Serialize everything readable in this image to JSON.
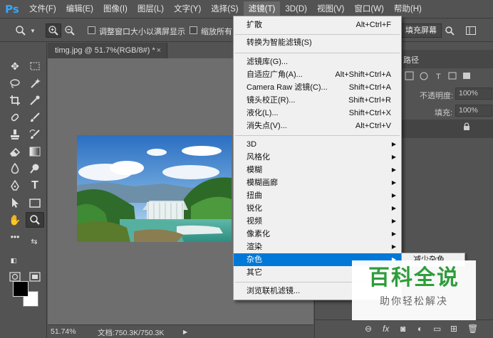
{
  "app": {
    "logo": "Ps"
  },
  "menubar": {
    "items": [
      "文件(F)",
      "编辑(E)",
      "图像(I)",
      "图层(L)",
      "文字(Y)",
      "选择(S)",
      "滤镜(T)",
      "3D(D)",
      "视图(V)",
      "窗口(W)",
      "帮助(H)"
    ],
    "active_index": 6
  },
  "options_bar": {
    "resize_windows_label": "调整窗口大小以满屏显示",
    "zoom_all_label": "缩放所有",
    "fill_screen_label": "填充屏幕"
  },
  "document": {
    "tab_title": "timg.jpg @ 51.7%(RGB/8#) *",
    "tab_close": "×",
    "zoom": "51.74%",
    "doc_info": "文档:750.3K/750.3K",
    "status_arrow": "▶"
  },
  "panels": {
    "tab_path": "路径",
    "opacity_label": "不透明度:",
    "opacity_value": "100%",
    "fill_label": "填充:",
    "fill_value": "100%",
    "lock_icon": "🔒"
  },
  "filter_menu": {
    "groups": [
      [
        {
          "label": "扩散",
          "shortcut": "Alt+Ctrl+F"
        }
      ],
      [
        {
          "label": "转换为智能滤镜(S)",
          "shortcut": ""
        }
      ],
      [
        {
          "label": "滤镜库(G)...",
          "shortcut": ""
        },
        {
          "label": "自适应广角(A)...",
          "shortcut": "Alt+Shift+Ctrl+A"
        },
        {
          "label": "Camera Raw 滤镜(C)...",
          "shortcut": "Shift+Ctrl+A"
        },
        {
          "label": "镜头校正(R)...",
          "shortcut": "Shift+Ctrl+R"
        },
        {
          "label": "液化(L)...",
          "shortcut": "Shift+Ctrl+X"
        },
        {
          "label": "消失点(V)...",
          "shortcut": "Alt+Ctrl+V"
        }
      ],
      [
        {
          "label": "3D",
          "submenu": true
        },
        {
          "label": "风格化",
          "submenu": true
        },
        {
          "label": "模糊",
          "submenu": true
        },
        {
          "label": "模糊画廊",
          "submenu": true
        },
        {
          "label": "扭曲",
          "submenu": true
        },
        {
          "label": "锐化",
          "submenu": true
        },
        {
          "label": "视频",
          "submenu": true
        },
        {
          "label": "像素化",
          "submenu": true
        },
        {
          "label": "渲染",
          "submenu": true
        },
        {
          "label": "杂色",
          "submenu": true,
          "highlighted": true
        },
        {
          "label": "其它",
          "submenu": true
        }
      ],
      [
        {
          "label": "浏览联机滤镜...",
          "shortcut": ""
        }
      ]
    ]
  },
  "submenu": {
    "first_item": "减少杂色..."
  },
  "watermark": {
    "title": "百科全说",
    "subtitle": "助你轻松解决"
  },
  "colors": {
    "highlight": "#0078d7",
    "ps_blue": "#31a8ff",
    "watermark_green": "#2e9d3a"
  }
}
